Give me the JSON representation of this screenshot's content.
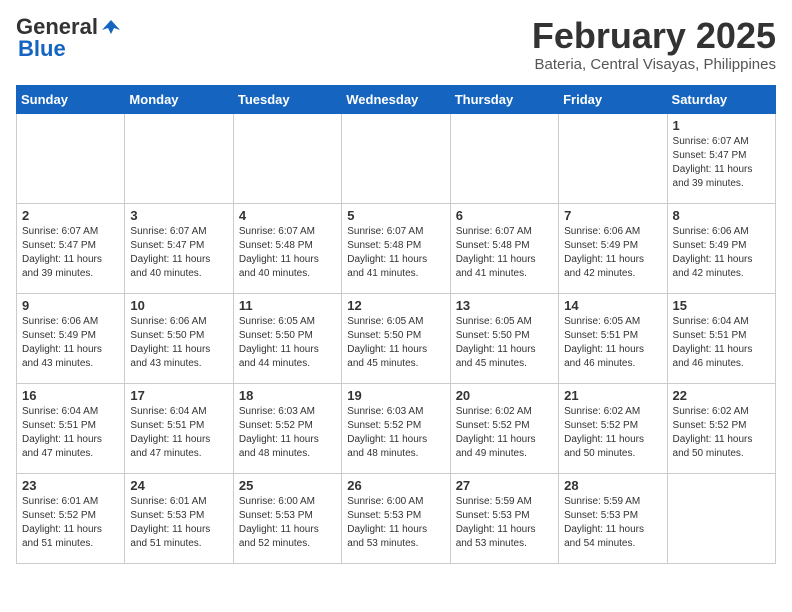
{
  "header": {
    "logo_general": "General",
    "logo_blue": "Blue",
    "title": "February 2025",
    "subtitle": "Bateria, Central Visayas, Philippines"
  },
  "weekdays": [
    "Sunday",
    "Monday",
    "Tuesday",
    "Wednesday",
    "Thursday",
    "Friday",
    "Saturday"
  ],
  "weeks": [
    [
      {
        "day": "",
        "info": ""
      },
      {
        "day": "",
        "info": ""
      },
      {
        "day": "",
        "info": ""
      },
      {
        "day": "",
        "info": ""
      },
      {
        "day": "",
        "info": ""
      },
      {
        "day": "",
        "info": ""
      },
      {
        "day": "1",
        "info": "Sunrise: 6:07 AM\nSunset: 5:47 PM\nDaylight: 11 hours\nand 39 minutes."
      }
    ],
    [
      {
        "day": "2",
        "info": "Sunrise: 6:07 AM\nSunset: 5:47 PM\nDaylight: 11 hours\nand 39 minutes."
      },
      {
        "day": "3",
        "info": "Sunrise: 6:07 AM\nSunset: 5:47 PM\nDaylight: 11 hours\nand 40 minutes."
      },
      {
        "day": "4",
        "info": "Sunrise: 6:07 AM\nSunset: 5:48 PM\nDaylight: 11 hours\nand 40 minutes."
      },
      {
        "day": "5",
        "info": "Sunrise: 6:07 AM\nSunset: 5:48 PM\nDaylight: 11 hours\nand 41 minutes."
      },
      {
        "day": "6",
        "info": "Sunrise: 6:07 AM\nSunset: 5:48 PM\nDaylight: 11 hours\nand 41 minutes."
      },
      {
        "day": "7",
        "info": "Sunrise: 6:06 AM\nSunset: 5:49 PM\nDaylight: 11 hours\nand 42 minutes."
      },
      {
        "day": "8",
        "info": "Sunrise: 6:06 AM\nSunset: 5:49 PM\nDaylight: 11 hours\nand 42 minutes."
      }
    ],
    [
      {
        "day": "9",
        "info": "Sunrise: 6:06 AM\nSunset: 5:49 PM\nDaylight: 11 hours\nand 43 minutes."
      },
      {
        "day": "10",
        "info": "Sunrise: 6:06 AM\nSunset: 5:50 PM\nDaylight: 11 hours\nand 43 minutes."
      },
      {
        "day": "11",
        "info": "Sunrise: 6:05 AM\nSunset: 5:50 PM\nDaylight: 11 hours\nand 44 minutes."
      },
      {
        "day": "12",
        "info": "Sunrise: 6:05 AM\nSunset: 5:50 PM\nDaylight: 11 hours\nand 45 minutes."
      },
      {
        "day": "13",
        "info": "Sunrise: 6:05 AM\nSunset: 5:50 PM\nDaylight: 11 hours\nand 45 minutes."
      },
      {
        "day": "14",
        "info": "Sunrise: 6:05 AM\nSunset: 5:51 PM\nDaylight: 11 hours\nand 46 minutes."
      },
      {
        "day": "15",
        "info": "Sunrise: 6:04 AM\nSunset: 5:51 PM\nDaylight: 11 hours\nand 46 minutes."
      }
    ],
    [
      {
        "day": "16",
        "info": "Sunrise: 6:04 AM\nSunset: 5:51 PM\nDaylight: 11 hours\nand 47 minutes."
      },
      {
        "day": "17",
        "info": "Sunrise: 6:04 AM\nSunset: 5:51 PM\nDaylight: 11 hours\nand 47 minutes."
      },
      {
        "day": "18",
        "info": "Sunrise: 6:03 AM\nSunset: 5:52 PM\nDaylight: 11 hours\nand 48 minutes."
      },
      {
        "day": "19",
        "info": "Sunrise: 6:03 AM\nSunset: 5:52 PM\nDaylight: 11 hours\nand 48 minutes."
      },
      {
        "day": "20",
        "info": "Sunrise: 6:02 AM\nSunset: 5:52 PM\nDaylight: 11 hours\nand 49 minutes."
      },
      {
        "day": "21",
        "info": "Sunrise: 6:02 AM\nSunset: 5:52 PM\nDaylight: 11 hours\nand 50 minutes."
      },
      {
        "day": "22",
        "info": "Sunrise: 6:02 AM\nSunset: 5:52 PM\nDaylight: 11 hours\nand 50 minutes."
      }
    ],
    [
      {
        "day": "23",
        "info": "Sunrise: 6:01 AM\nSunset: 5:52 PM\nDaylight: 11 hours\nand 51 minutes."
      },
      {
        "day": "24",
        "info": "Sunrise: 6:01 AM\nSunset: 5:53 PM\nDaylight: 11 hours\nand 51 minutes."
      },
      {
        "day": "25",
        "info": "Sunrise: 6:00 AM\nSunset: 5:53 PM\nDaylight: 11 hours\nand 52 minutes."
      },
      {
        "day": "26",
        "info": "Sunrise: 6:00 AM\nSunset: 5:53 PM\nDaylight: 11 hours\nand 53 minutes."
      },
      {
        "day": "27",
        "info": "Sunrise: 5:59 AM\nSunset: 5:53 PM\nDaylight: 11 hours\nand 53 minutes."
      },
      {
        "day": "28",
        "info": "Sunrise: 5:59 AM\nSunset: 5:53 PM\nDaylight: 11 hours\nand 54 minutes."
      },
      {
        "day": "",
        "info": ""
      }
    ]
  ]
}
